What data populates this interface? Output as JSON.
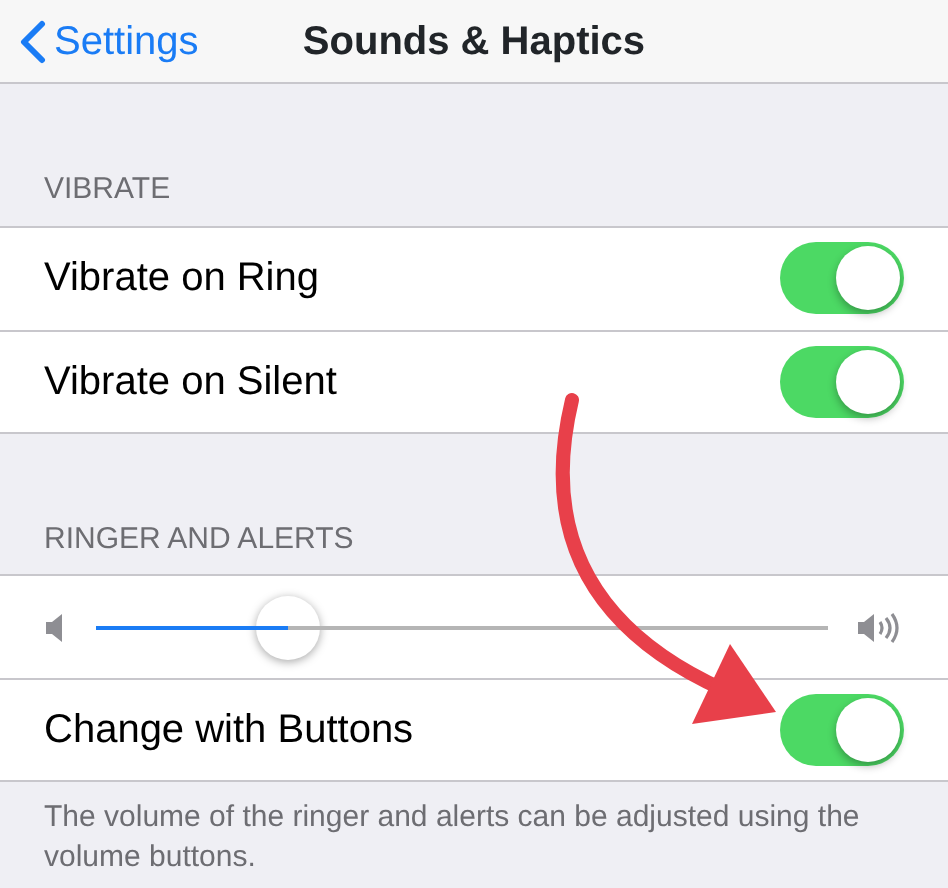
{
  "nav": {
    "back_label": "Settings",
    "title": "Sounds & Haptics"
  },
  "sections": [
    {
      "header": "VIBRATE",
      "rows": [
        {
          "kind": "switch",
          "label": "Vibrate on Ring",
          "on": true
        },
        {
          "kind": "switch",
          "label": "Vibrate on Silent",
          "on": true
        }
      ]
    },
    {
      "header": "RINGER AND ALERTS",
      "rows": [
        {
          "kind": "slider",
          "level": 0.24
        },
        {
          "kind": "switch",
          "label": "Change with Buttons",
          "on": true
        }
      ],
      "footer": "The volume of the ringer and alerts can be adjusted using the volume buttons."
    }
  ]
}
